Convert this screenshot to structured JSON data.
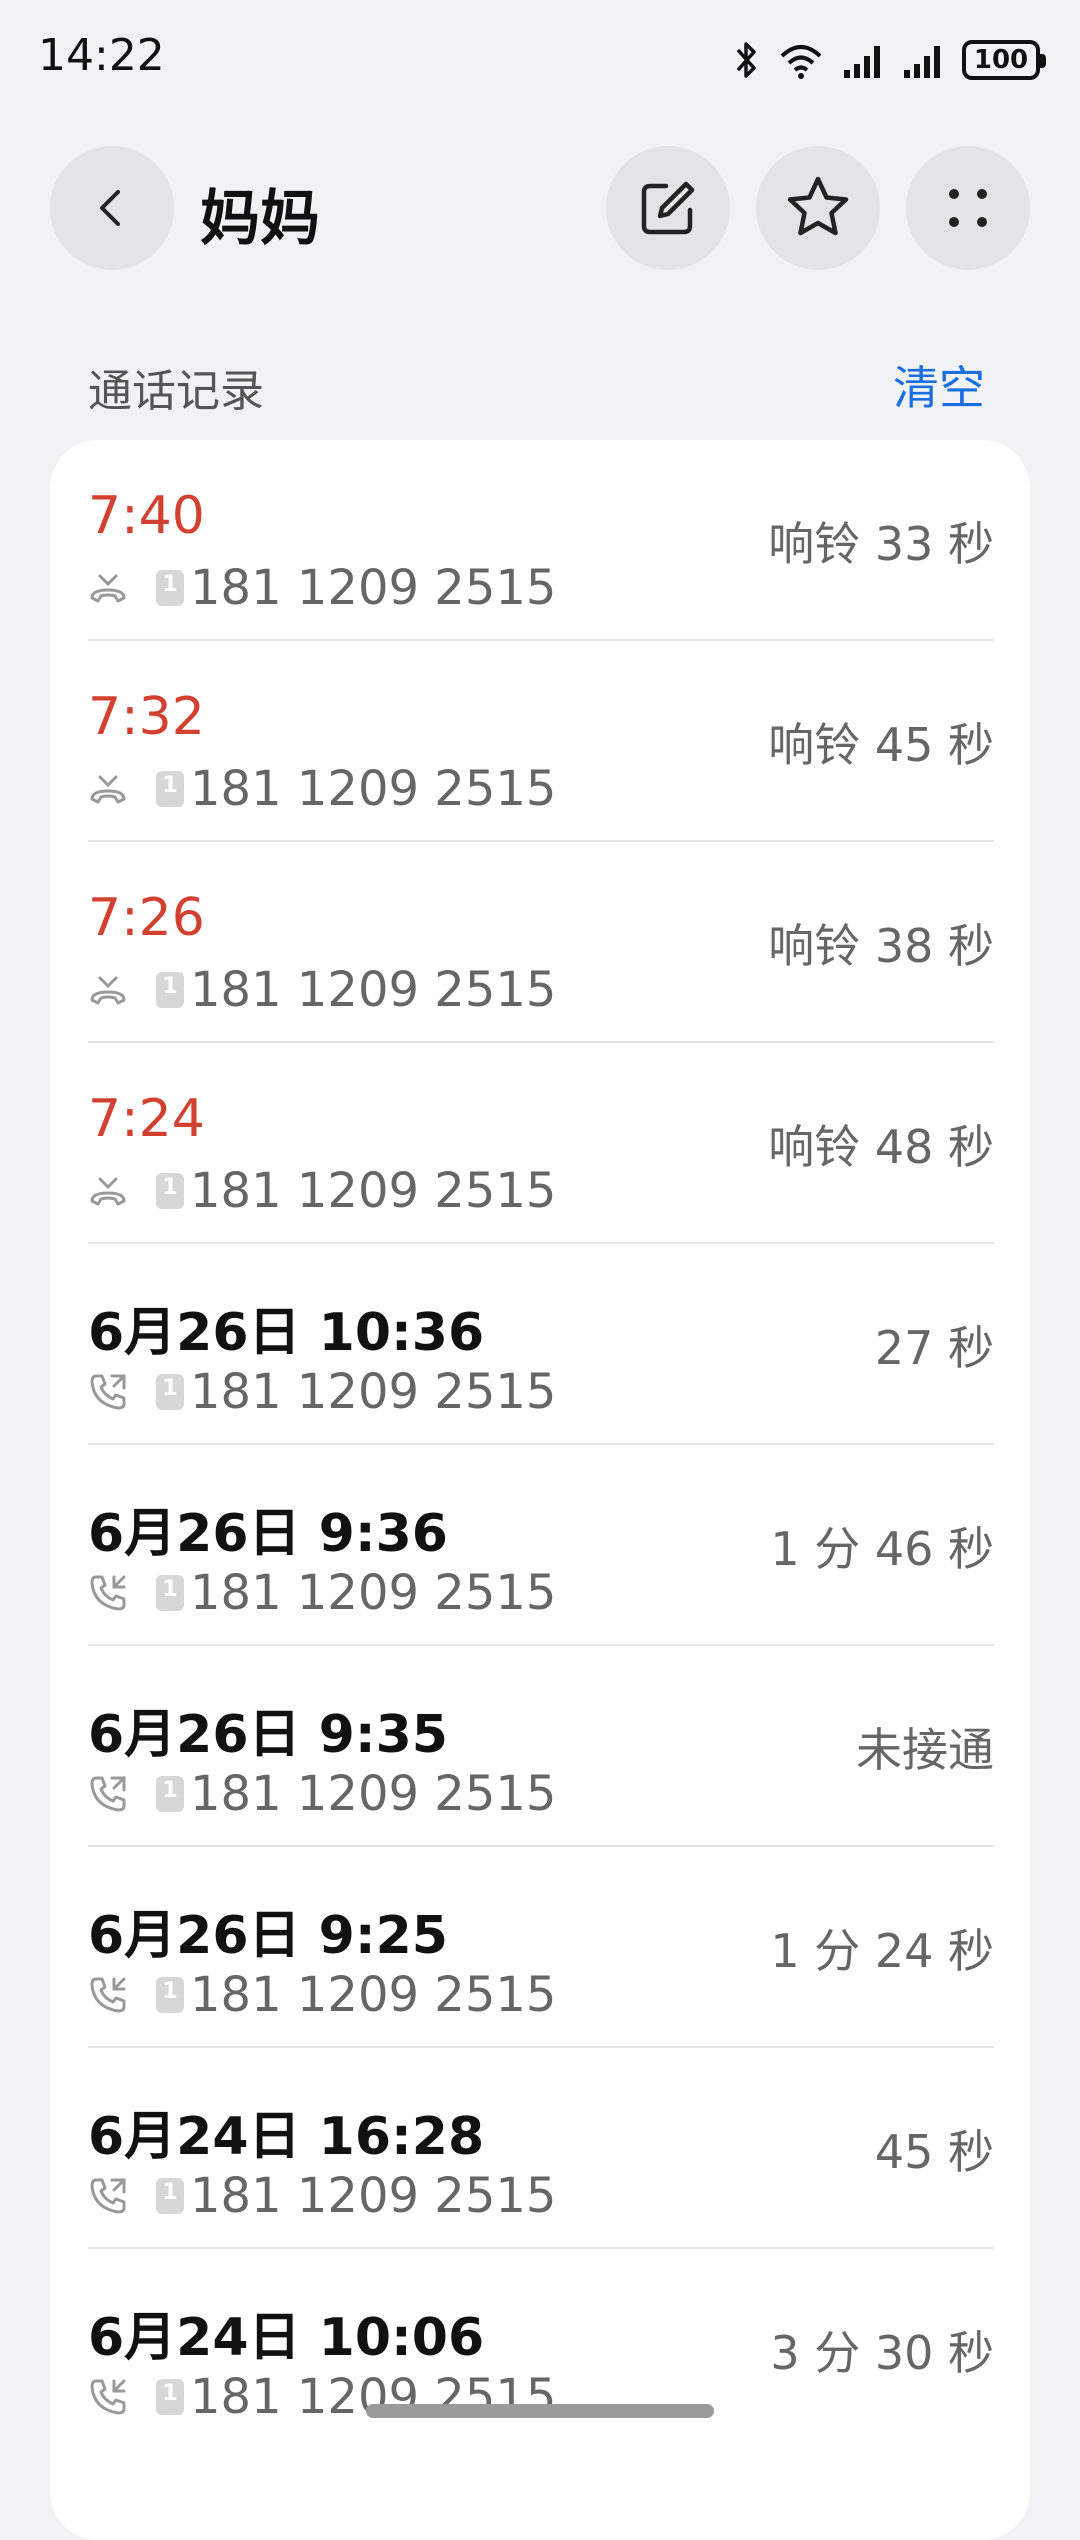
{
  "status_bar": {
    "time": "14:22",
    "battery": "100",
    "icons": [
      "bluetooth-icon",
      "wifi-icon",
      "signal-icon",
      "signal-icon"
    ]
  },
  "header": {
    "contact_name": "妈妈",
    "icons": [
      "back-icon",
      "edit-icon",
      "star-icon",
      "more-icon"
    ]
  },
  "call_log": {
    "title": "通话记录",
    "clear_label": "清空",
    "rows": [
      {
        "time": "7:40",
        "number": "181 1209 2515",
        "duration": "响铃 33 秒",
        "type": "missed"
      },
      {
        "time": "7:32",
        "number": "181 1209 2515",
        "duration": "响铃 45 秒",
        "type": "missed"
      },
      {
        "time": "7:26",
        "number": "181 1209 2515",
        "duration": "响铃 38 秒",
        "type": "missed"
      },
      {
        "time": "7:24",
        "number": "181 1209 2515",
        "duration": "响铃 48 秒",
        "type": "missed"
      },
      {
        "time": "6月26日 10:36",
        "number": "181 1209 2515",
        "duration": "27 秒",
        "type": "outgoing"
      },
      {
        "time": "6月26日 9:36",
        "number": "181 1209 2515",
        "duration": "1 分 46 秒",
        "type": "incoming"
      },
      {
        "time": "6月26日 9:35",
        "number": "181 1209 2515",
        "duration": "未接通",
        "type": "outgoing"
      },
      {
        "time": "6月26日 9:25",
        "number": "181 1209 2515",
        "duration": "1 分 24 秒",
        "type": "incoming"
      },
      {
        "time": "6月24日 16:28",
        "number": "181 1209 2515",
        "duration": "45 秒",
        "type": "outgoing"
      },
      {
        "time": "6月24日 10:06",
        "number": "181 1209 2515",
        "duration": "3 分 30 秒",
        "type": "incoming"
      }
    ]
  },
  "colors": {
    "missed": "#d2402f",
    "accent": "#1a6fe0"
  }
}
